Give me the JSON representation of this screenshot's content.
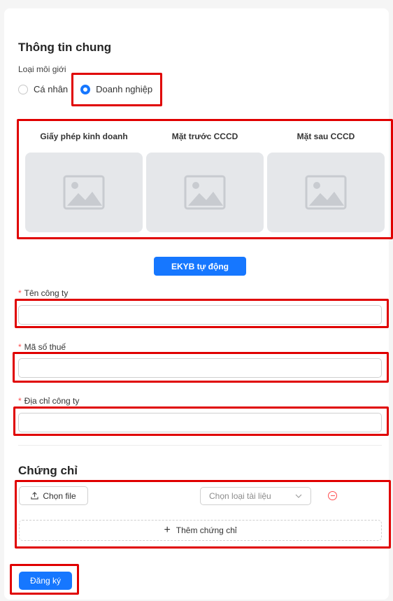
{
  "general": {
    "title": "Thông tin chung",
    "broker_type_label": "Loại môi giới",
    "options": [
      "Cá nhân",
      "Doanh nghiệp"
    ],
    "selected": "Doanh nghiệp"
  },
  "uploads": [
    {
      "label": "Giấy phép kinh doanh",
      "icon": "image-placeholder-icon"
    },
    {
      "label": "Mặt trước CCCD",
      "icon": "image-placeholder-icon"
    },
    {
      "label": "Mặt sau CCCD",
      "icon": "image-placeholder-icon"
    }
  ],
  "ekyb_button": "EKYB tự động",
  "fields": {
    "company_name": {
      "label": "Tên công ty",
      "required_mark": "*",
      "value": ""
    },
    "tax_code": {
      "label": "Mã số thuế",
      "required_mark": "*",
      "value": ""
    },
    "company_address": {
      "label": "Địa chỉ công ty",
      "required_mark": "*",
      "value": ""
    }
  },
  "certificates": {
    "title": "Chứng chỉ",
    "choose_file": "Chọn file",
    "doc_type_placeholder": "Chọn loại tài liệu",
    "add_certificate": "Thêm chứng chỉ"
  },
  "submit_button": "Đăng ký",
  "colors": {
    "primary": "#1677ff",
    "highlight": "#e00000",
    "danger": "#ff4d4f"
  }
}
